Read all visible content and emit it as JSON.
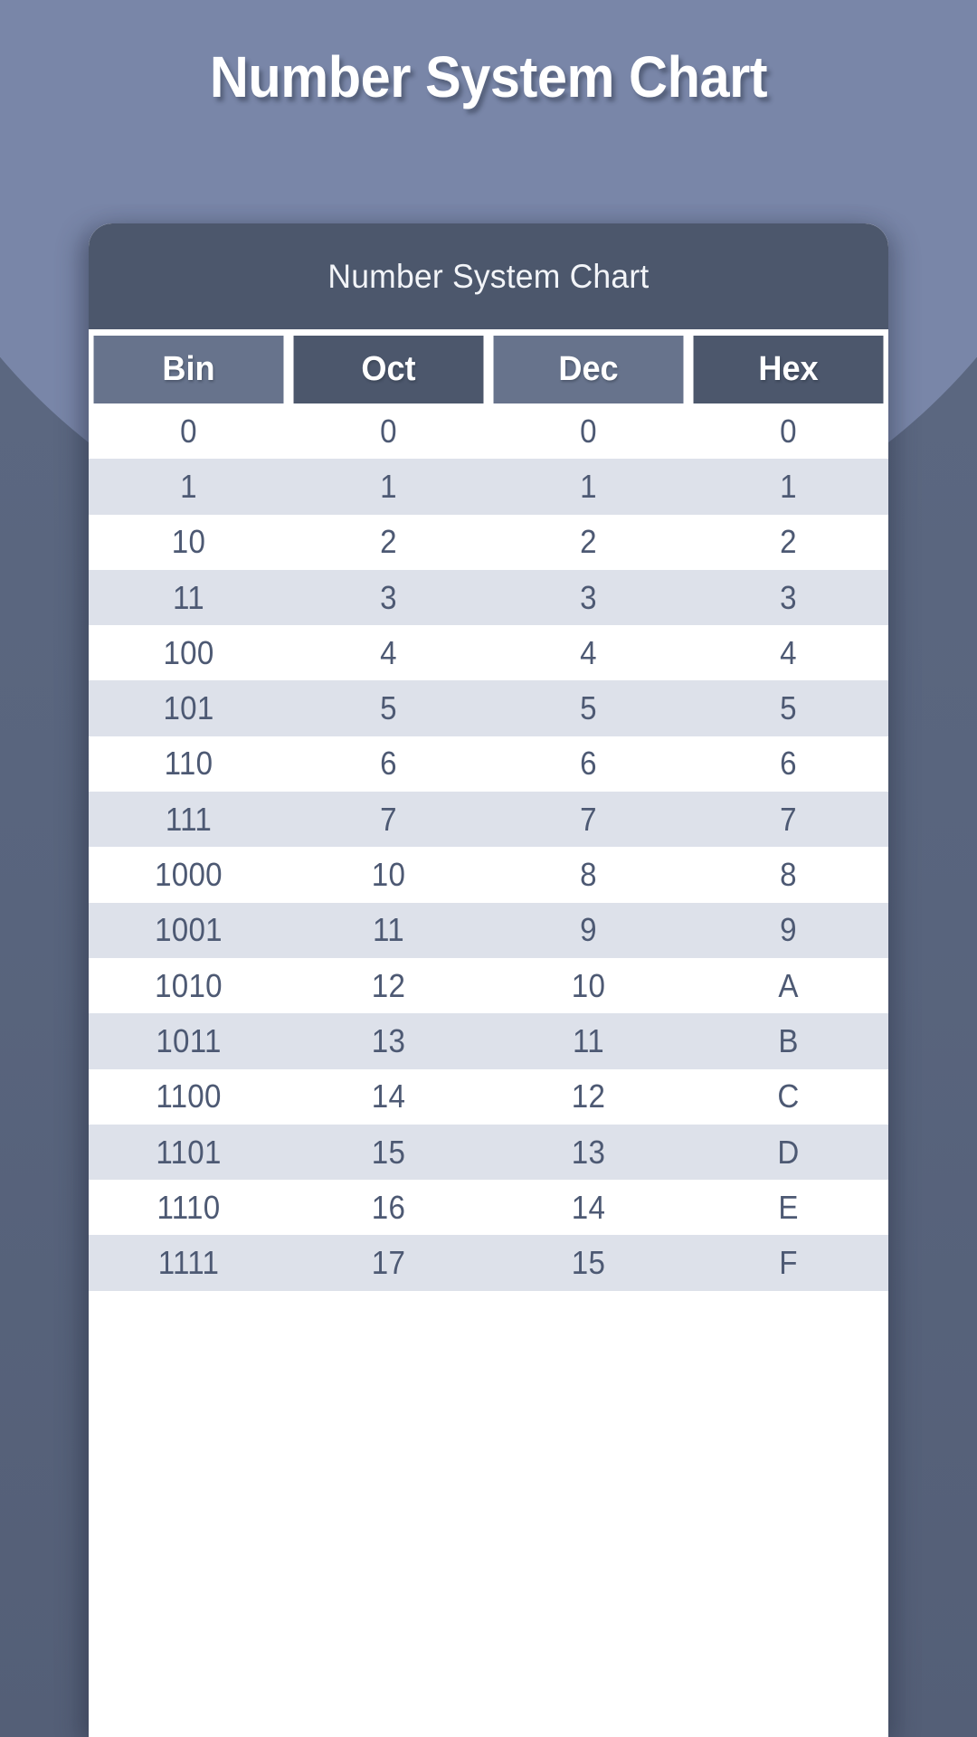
{
  "page": {
    "title": "Number System Chart",
    "background_color": "#5c6882",
    "accent_light": "#7986a8",
    "card_background": "#ffffff"
  },
  "card": {
    "header_title": "Number System Chart",
    "header_background": "#4c576c",
    "header_rule_color": "#ffffff"
  },
  "table": {
    "columns": [
      {
        "label": "Bin",
        "shade": "#67738c"
      },
      {
        "label": "Oct",
        "shade": "#4c576c"
      },
      {
        "label": "Dec",
        "shade": "#67738c"
      },
      {
        "label": "Hex",
        "shade": "#4c576c"
      }
    ],
    "row_stripe_odd": "#ffffff",
    "row_stripe_even": "#dde1ea",
    "cell_text_color": "#4d5973",
    "rows": [
      [
        "0",
        "0",
        "0",
        "0"
      ],
      [
        "1",
        "1",
        "1",
        "1"
      ],
      [
        "10",
        "2",
        "2",
        "2"
      ],
      [
        "11",
        "3",
        "3",
        "3"
      ],
      [
        "100",
        "4",
        "4",
        "4"
      ],
      [
        "101",
        "5",
        "5",
        "5"
      ],
      [
        "110",
        "6",
        "6",
        "6"
      ],
      [
        "111",
        "7",
        "7",
        "7"
      ],
      [
        "1000",
        "10",
        "8",
        "8"
      ],
      [
        "1001",
        "11",
        "9",
        "9"
      ],
      [
        "1010",
        "12",
        "10",
        "A"
      ],
      [
        "1011",
        "13",
        "11",
        "B"
      ],
      [
        "1100",
        "14",
        "12",
        "C"
      ],
      [
        "1101",
        "15",
        "13",
        "D"
      ],
      [
        "1110",
        "16",
        "14",
        "E"
      ],
      [
        "1111",
        "17",
        "15",
        "F"
      ]
    ]
  },
  "chart_data": {
    "type": "table",
    "title": "Number System Chart",
    "columns": [
      "Bin",
      "Oct",
      "Dec",
      "Hex"
    ],
    "rows": [
      [
        "0",
        "0",
        "0",
        "0"
      ],
      [
        "1",
        "1",
        "1",
        "1"
      ],
      [
        "10",
        "2",
        "2",
        "2"
      ],
      [
        "11",
        "3",
        "3",
        "3"
      ],
      [
        "100",
        "4",
        "4",
        "4"
      ],
      [
        "101",
        "5",
        "5",
        "5"
      ],
      [
        "110",
        "6",
        "6",
        "6"
      ],
      [
        "111",
        "7",
        "7",
        "7"
      ],
      [
        "1000",
        "10",
        "8",
        "8"
      ],
      [
        "1001",
        "11",
        "9",
        "9"
      ],
      [
        "1010",
        "12",
        "10",
        "A"
      ],
      [
        "1011",
        "13",
        "11",
        "B"
      ],
      [
        "1100",
        "14",
        "12",
        "C"
      ],
      [
        "1101",
        "15",
        "13",
        "D"
      ],
      [
        "1110",
        "16",
        "14",
        "E"
      ],
      [
        "1111",
        "17",
        "15",
        "F"
      ]
    ]
  }
}
